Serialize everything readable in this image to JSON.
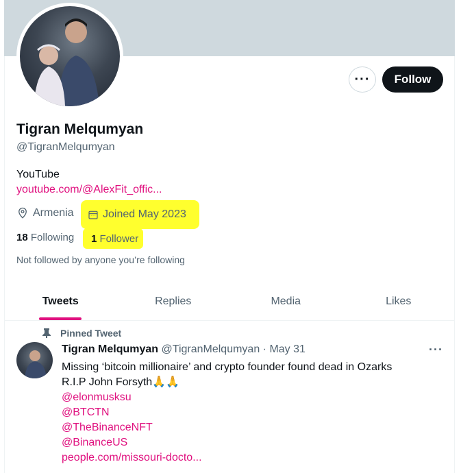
{
  "profile": {
    "name": "Tigran Melqumyan",
    "handle": "@TigranMelqumyan",
    "bio": "YouTube",
    "link": "youtube.com/@AlexFit_offic...",
    "location": "Armenia",
    "joined": "Joined May 2023",
    "following_count": "18",
    "following_label": "Following",
    "followers_count": "1",
    "followers_label": "Follower",
    "not_followed": "Not followed by anyone you’re following"
  },
  "actions": {
    "more_label": "···",
    "follow_label": "Follow"
  },
  "tabs": [
    {
      "label": "Tweets"
    },
    {
      "label": "Replies"
    },
    {
      "label": "Media"
    },
    {
      "label": "Likes"
    }
  ],
  "tweet": {
    "pinned_label": "Pinned Tweet",
    "author_name": "Tigran Melqumyan",
    "author_handle": "@TigranMelqumyan",
    "separator": " · ",
    "date": "May 31",
    "text_line1": "Missing ‘bitcoin millionaire’ and crypto founder found dead in Ozarks",
    "text_line2": "R.I.P John Forsyth🙏🙏",
    "mentions": [
      "@elonmusksu",
      "@BTCTN",
      "@TheBinanceNFT",
      "@BinanceUS"
    ],
    "link": "people.com/missouri-docto...",
    "more_label": "···"
  },
  "colors": {
    "accent": "#e0117f",
    "highlight": "#ffff2e",
    "banner": "#cfd9de",
    "follow_bg": "#0f1419"
  },
  "icons": [
    "location-pin-icon",
    "calendar-icon",
    "pin-icon",
    "more-horizontal-icon"
  ]
}
